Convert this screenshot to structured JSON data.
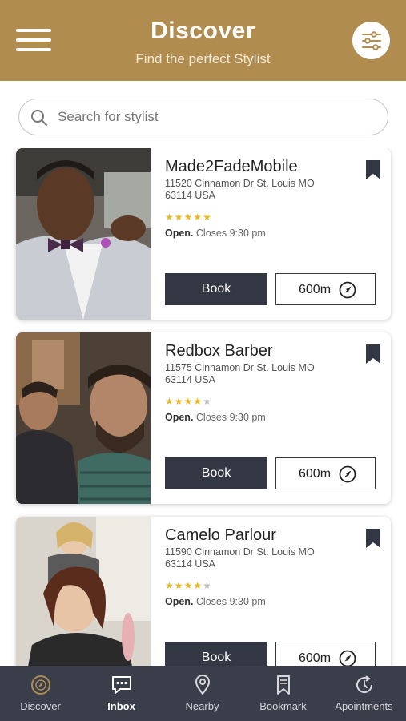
{
  "header": {
    "title": "Discover",
    "subtitle": "Find the perfect Stylist"
  },
  "search": {
    "placeholder": "Search for stylist",
    "value": ""
  },
  "stylists": [
    {
      "name": "Made2FadeMobile",
      "address": "11520 Cinnamon Dr St. Louis MO 63114 USA",
      "rating": 5,
      "status": "Open.",
      "hours": "Closes 9:30 pm",
      "book_label": "Book",
      "distance": "600m"
    },
    {
      "name": "Redbox Barber",
      "address": "11575 Cinnamon Dr St. Louis MO 63114 USA",
      "rating": 4,
      "status": "Open.",
      "hours": "Closes 9:30 pm",
      "book_label": "Book",
      "distance": "600m"
    },
    {
      "name": "Camelo Parlour",
      "address": "11590 Cinnamon Dr St. Louis MO 63114 USA",
      "rating": 4,
      "status": "Open.",
      "hours": "Closes 9:30 pm",
      "book_label": "Book",
      "distance": "600m"
    }
  ],
  "tabs": [
    {
      "label": "Discover",
      "icon": "discover-icon"
    },
    {
      "label": "Inbox",
      "icon": "chat-icon"
    },
    {
      "label": "Nearby",
      "icon": "location-pin-icon"
    },
    {
      "label": "Bookmark",
      "icon": "bookmark-icon"
    },
    {
      "label": "Apointments",
      "icon": "refresh-clock-icon"
    }
  ],
  "active_tab": "Inbox",
  "colors": {
    "header_bg": "#b08d4f",
    "tabbar_bg": "#3a3d4a",
    "button_dark": "#333744",
    "star": "#e9b722"
  }
}
